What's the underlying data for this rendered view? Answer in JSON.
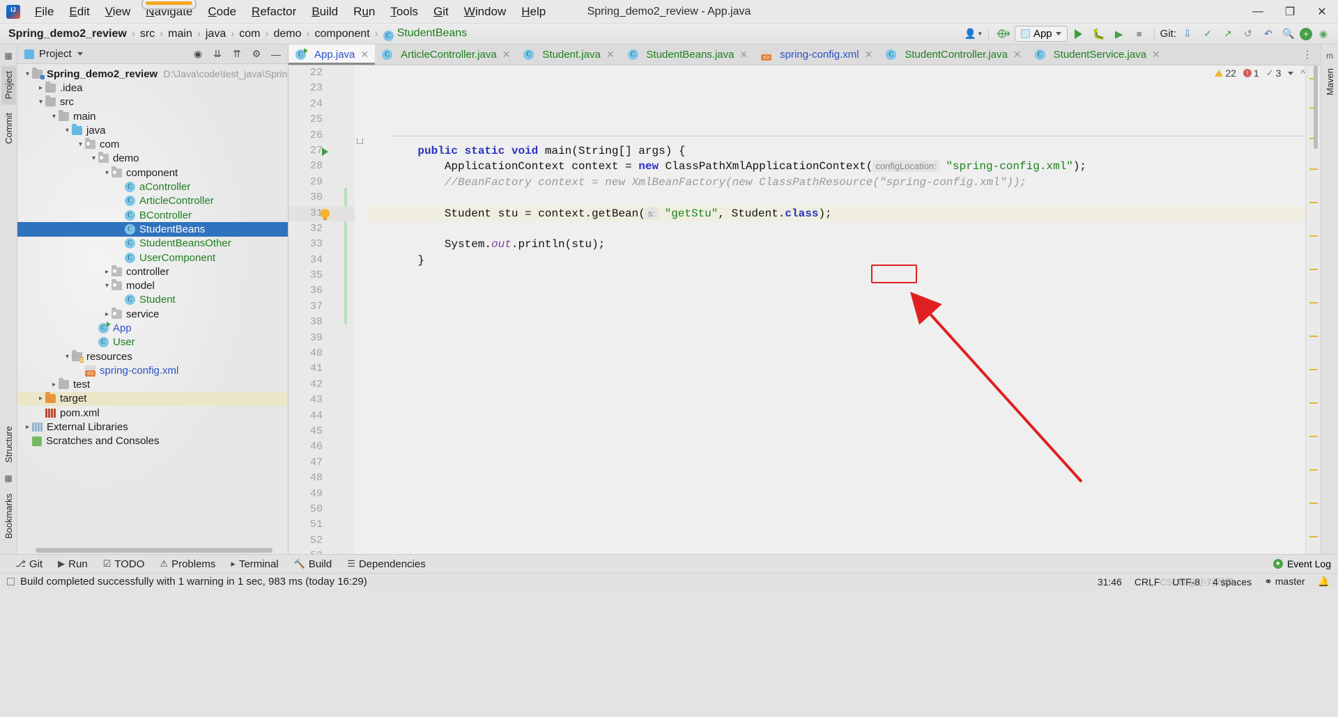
{
  "window": {
    "title": "Spring_demo2_review - App.java",
    "controls": {
      "minimize": "—",
      "maximize": "❐",
      "close": "✕"
    }
  },
  "menu": [
    {
      "pre": "",
      "mn": "F",
      "post": "ile",
      "name": "file"
    },
    {
      "pre": "",
      "mn": "E",
      "post": "dit",
      "name": "edit"
    },
    {
      "pre": "",
      "mn": "V",
      "post": "iew",
      "name": "view"
    },
    {
      "pre": "",
      "mn": "N",
      "post": "avigate",
      "name": "navigate",
      "highlighted": true
    },
    {
      "pre": "",
      "mn": "C",
      "post": "ode",
      "name": "code"
    },
    {
      "pre": "",
      "mn": "R",
      "post": "efactor",
      "name": "refactor"
    },
    {
      "pre": "",
      "mn": "B",
      "post": "uild",
      "name": "build"
    },
    {
      "pre": "R",
      "mn": "u",
      "post": "n",
      "name": "run"
    },
    {
      "pre": "",
      "mn": "T",
      "post": "ools",
      "name": "tools"
    },
    {
      "pre": "",
      "mn": "G",
      "post": "it",
      "name": "git"
    },
    {
      "pre": "",
      "mn": "W",
      "post": "indow",
      "name": "window"
    },
    {
      "pre": "",
      "mn": "H",
      "post": "elp",
      "name": "help"
    }
  ],
  "breadcrumb": {
    "items": [
      "Spring_demo2_review",
      "src",
      "main",
      "java",
      "com",
      "demo",
      "component"
    ],
    "last": "StudentBeans",
    "separator": "›"
  },
  "toolbar": {
    "run_config_label": "App",
    "git_label": "Git:",
    "run_tooltip": "Run",
    "debug_tooltip": "Debug",
    "stop_tooltip": "Stop",
    "search_tooltip": "Search Everywhere",
    "update_tooltip": "Update Project"
  },
  "project_panel": {
    "title": "Project",
    "tree": [
      {
        "depth": 0,
        "arrow": "open",
        "icon": "module",
        "label": "Spring_demo2_review",
        "color": "plain",
        "bold": true,
        "path": "D:\\Java\\code\\test_java\\Spring_dem"
      },
      {
        "depth": 1,
        "arrow": "closed",
        "icon": "folder",
        "label": ".idea",
        "color": "plain"
      },
      {
        "depth": 1,
        "arrow": "open",
        "icon": "folder",
        "label": "src",
        "color": "plain"
      },
      {
        "depth": 2,
        "arrow": "open",
        "icon": "folder",
        "label": "main",
        "color": "plain"
      },
      {
        "depth": 3,
        "arrow": "open",
        "icon": "source",
        "label": "java",
        "color": "plain"
      },
      {
        "depth": 4,
        "arrow": "open",
        "icon": "package",
        "label": "com",
        "color": "plain"
      },
      {
        "depth": 5,
        "arrow": "open",
        "icon": "package",
        "label": "demo",
        "color": "plain"
      },
      {
        "depth": 6,
        "arrow": "open",
        "icon": "package",
        "label": "component",
        "color": "plain"
      },
      {
        "depth": 7,
        "arrow": "none",
        "icon": "class",
        "label": "aController",
        "color": "green"
      },
      {
        "depth": 7,
        "arrow": "none",
        "icon": "class",
        "label": "ArticleController",
        "color": "green"
      },
      {
        "depth": 7,
        "arrow": "none",
        "icon": "class",
        "label": "BController",
        "color": "green"
      },
      {
        "depth": 7,
        "arrow": "none",
        "icon": "class",
        "label": "StudentBeans",
        "color": "green",
        "selected": true
      },
      {
        "depth": 7,
        "arrow": "none",
        "icon": "class",
        "label": "StudentBeansOther",
        "color": "green"
      },
      {
        "depth": 7,
        "arrow": "none",
        "icon": "class",
        "label": "UserComponent",
        "color": "green"
      },
      {
        "depth": 6,
        "arrow": "closed",
        "icon": "package",
        "label": "controller",
        "color": "plain"
      },
      {
        "depth": 6,
        "arrow": "open",
        "icon": "package",
        "label": "model",
        "color": "plain"
      },
      {
        "depth": 7,
        "arrow": "none",
        "icon": "class",
        "label": "Student",
        "color": "green"
      },
      {
        "depth": 6,
        "arrow": "closed",
        "icon": "package",
        "label": "service",
        "color": "plain"
      },
      {
        "depth": 5,
        "arrow": "none",
        "icon": "class-runnable",
        "label": "App",
        "color": "blue"
      },
      {
        "depth": 5,
        "arrow": "none",
        "icon": "class",
        "label": "User",
        "color": "green"
      },
      {
        "depth": 3,
        "arrow": "open",
        "icon": "resources",
        "label": "resources",
        "color": "plain"
      },
      {
        "depth": 4,
        "arrow": "none",
        "icon": "xml",
        "label": "spring-config.xml",
        "color": "blue"
      },
      {
        "depth": 2,
        "arrow": "closed",
        "icon": "folder",
        "label": "test",
        "color": "plain"
      },
      {
        "depth": 1,
        "arrow": "closed",
        "icon": "target",
        "label": "target",
        "color": "plain",
        "highlighted": true
      },
      {
        "depth": 1,
        "arrow": "none",
        "icon": "maven",
        "label": "pom.xml",
        "color": "plain"
      },
      {
        "depth": 0,
        "arrow": "closed",
        "icon": "library",
        "label": "External Libraries",
        "color": "plain"
      },
      {
        "depth": 0,
        "arrow": "none",
        "icon": "scratch",
        "label": "Scratches and Consoles",
        "color": "plain"
      }
    ]
  },
  "left_strip": {
    "tabs": [
      "Project",
      "Commit"
    ],
    "bottom_tabs": [
      "Structure",
      "Bookmarks"
    ]
  },
  "right_strip": {
    "tabs": [
      "Maven"
    ]
  },
  "editor": {
    "tabs": [
      {
        "label": "App.java",
        "icon": "class-runnable",
        "active": true,
        "color": "blue"
      },
      {
        "label": "ArticleController.java",
        "icon": "class",
        "active": false,
        "color": "green"
      },
      {
        "label": "Student.java",
        "icon": "class",
        "active": false,
        "color": "green"
      },
      {
        "label": "StudentBeans.java",
        "icon": "class",
        "active": false,
        "color": "green"
      },
      {
        "label": "spring-config.xml",
        "icon": "xml",
        "active": false,
        "color": "blue"
      },
      {
        "label": "StudentController.java",
        "icon": "class",
        "active": false,
        "color": "green"
      },
      {
        "label": "StudentService.java",
        "icon": "class",
        "active": false,
        "color": "green"
      }
    ],
    "inspection": {
      "warnings": "22",
      "errors": "1",
      "checks": "3"
    },
    "first_line_number": 22,
    "lines": [
      {
        "n": 22,
        "segments": []
      },
      {
        "n": 23,
        "segments": []
      },
      {
        "n": 24,
        "segments": []
      },
      {
        "n": 25,
        "segments": []
      },
      {
        "n": 26,
        "segments": []
      },
      {
        "n": 27,
        "gutter": "run",
        "segments": [
          {
            "t": "    ",
            "c": "plain"
          },
          {
            "t": "public",
            "c": "kw"
          },
          {
            "t": " ",
            "c": "plain"
          },
          {
            "t": "static",
            "c": "kw"
          },
          {
            "t": " ",
            "c": "plain"
          },
          {
            "t": "void",
            "c": "kw"
          },
          {
            "t": " ",
            "c": "plain"
          },
          {
            "t": "main",
            "c": "mth"
          },
          {
            "t": "(String[] args) {",
            "c": "plain"
          }
        ]
      },
      {
        "n": 28,
        "segments": [
          {
            "t": "        ApplicationContext context = ",
            "c": "plain"
          },
          {
            "t": "new",
            "c": "kw"
          },
          {
            "t": " ClassPathXmlApplicationContext(",
            "c": "plain"
          },
          {
            "t": "configLocation:",
            "c": "hint"
          },
          {
            "t": " ",
            "c": "plain"
          },
          {
            "t": "\"spring-config.xml\"",
            "c": "str"
          },
          {
            "t": ");",
            "c": "plain"
          }
        ]
      },
      {
        "n": 29,
        "segments": [
          {
            "t": "        //BeanFactory context = new XmlBeanFactory(new ClassPathResource(\"spring-config.xml\"));",
            "c": "cmt"
          }
        ]
      },
      {
        "n": 30,
        "segments": []
      },
      {
        "n": 31,
        "gutter": "bulb",
        "current": true,
        "segments": [
          {
            "t": "        Student stu = context.getBean(",
            "c": "plain"
          },
          {
            "t": "s:",
            "c": "hint"
          },
          {
            "t": " ",
            "c": "plain"
          },
          {
            "t": "\"getStu\"",
            "c": "str",
            "boxed": true
          },
          {
            "t": ", Student.",
            "c": "plain"
          },
          {
            "t": "class",
            "c": "kw"
          },
          {
            "t": ");",
            "c": "plain"
          }
        ]
      },
      {
        "n": 32,
        "segments": []
      },
      {
        "n": 33,
        "segments": [
          {
            "t": "        System.",
            "c": "plain"
          },
          {
            "t": "out",
            "c": "fld"
          },
          {
            "t": ".println(stu);",
            "c": "plain"
          }
        ]
      },
      {
        "n": 34,
        "segments": [
          {
            "t": "    }",
            "c": "plain"
          }
        ]
      },
      {
        "n": 35,
        "segments": []
      },
      {
        "n": 36,
        "segments": []
      },
      {
        "n": 37,
        "segments": []
      },
      {
        "n": 38,
        "segments": []
      },
      {
        "n": 39,
        "segments": []
      },
      {
        "n": 40,
        "segments": []
      },
      {
        "n": 41,
        "segments": []
      },
      {
        "n": 42,
        "segments": []
      },
      {
        "n": 43,
        "segments": []
      },
      {
        "n": 44,
        "segments": []
      },
      {
        "n": 45,
        "segments": []
      },
      {
        "n": 46,
        "segments": []
      },
      {
        "n": 47,
        "segments": []
      },
      {
        "n": 48,
        "segments": []
      },
      {
        "n": 49,
        "segments": []
      },
      {
        "n": 50,
        "segments": []
      },
      {
        "n": 51,
        "segments": []
      },
      {
        "n": 52,
        "segments": []
      },
      {
        "n": 53,
        "segments": []
      }
    ]
  },
  "tool_window_bar": {
    "items": [
      {
        "label": "Git",
        "icon": "branch-icon"
      },
      {
        "label": "Run",
        "icon": "run-icon"
      },
      {
        "label": "TODO",
        "icon": "todo-icon"
      },
      {
        "label": "Problems",
        "icon": "problems-icon"
      },
      {
        "label": "Terminal",
        "icon": "terminal-icon"
      },
      {
        "label": "Build",
        "icon": "build-icon"
      },
      {
        "label": "Dependencies",
        "icon": "dependencies-icon"
      }
    ],
    "event_log": "Event Log"
  },
  "status_bar": {
    "message": "Build completed successfully with 1 warning in 1 sec, 983 ms (today 16:29)",
    "caret": "31:46",
    "line_separator": "CRLF",
    "encoding": "UTF-8",
    "indent": "4 spaces",
    "branch": "master",
    "watermark": "CSDN @小刘同学"
  }
}
